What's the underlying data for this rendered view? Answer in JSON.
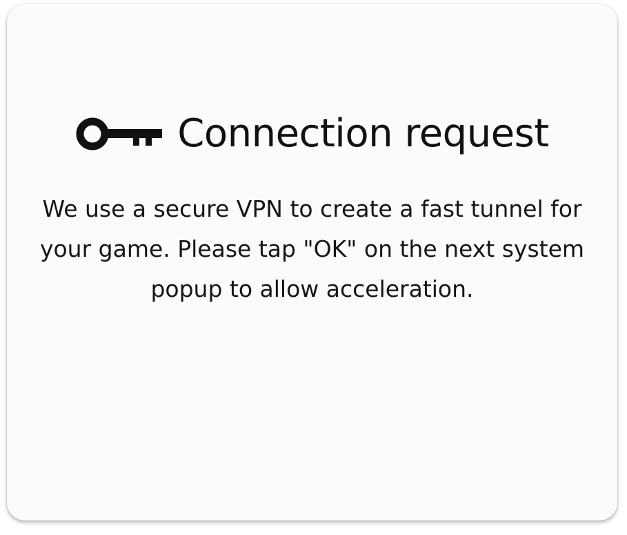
{
  "dialog": {
    "icon": "key-icon",
    "title": "Connection request",
    "message": "We use a secure VPN to create a fast tunnel for your game. Please tap \"OK\" on the next system popup to allow acceleration."
  },
  "colors": {
    "background": "#fcfbf9",
    "text": "#111111"
  }
}
